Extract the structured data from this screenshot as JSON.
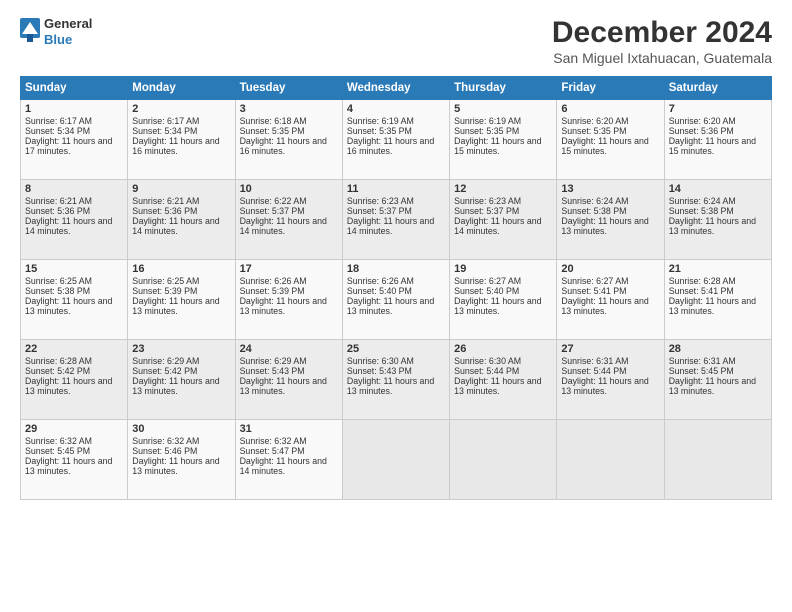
{
  "logo": {
    "general": "General",
    "blue": "Blue"
  },
  "title": "December 2024",
  "subtitle": "San Miguel Ixtahuacan, Guatemala",
  "days_of_week": [
    "Sunday",
    "Monday",
    "Tuesday",
    "Wednesday",
    "Thursday",
    "Friday",
    "Saturday"
  ],
  "weeks": [
    [
      {
        "day": "1",
        "sunrise": "6:17 AM",
        "sunset": "5:34 PM",
        "daylight": "11 hours and 17 minutes."
      },
      {
        "day": "2",
        "sunrise": "6:17 AM",
        "sunset": "5:34 PM",
        "daylight": "11 hours and 16 minutes."
      },
      {
        "day": "3",
        "sunrise": "6:18 AM",
        "sunset": "5:35 PM",
        "daylight": "11 hours and 16 minutes."
      },
      {
        "day": "4",
        "sunrise": "6:19 AM",
        "sunset": "5:35 PM",
        "daylight": "11 hours and 16 minutes."
      },
      {
        "day": "5",
        "sunrise": "6:19 AM",
        "sunset": "5:35 PM",
        "daylight": "11 hours and 15 minutes."
      },
      {
        "day": "6",
        "sunrise": "6:20 AM",
        "sunset": "5:35 PM",
        "daylight": "11 hours and 15 minutes."
      },
      {
        "day": "7",
        "sunrise": "6:20 AM",
        "sunset": "5:36 PM",
        "daylight": "11 hours and 15 minutes."
      }
    ],
    [
      {
        "day": "8",
        "sunrise": "6:21 AM",
        "sunset": "5:36 PM",
        "daylight": "11 hours and 14 minutes."
      },
      {
        "day": "9",
        "sunrise": "6:21 AM",
        "sunset": "5:36 PM",
        "daylight": "11 hours and 14 minutes."
      },
      {
        "day": "10",
        "sunrise": "6:22 AM",
        "sunset": "5:37 PM",
        "daylight": "11 hours and 14 minutes."
      },
      {
        "day": "11",
        "sunrise": "6:23 AM",
        "sunset": "5:37 PM",
        "daylight": "11 hours and 14 minutes."
      },
      {
        "day": "12",
        "sunrise": "6:23 AM",
        "sunset": "5:37 PM",
        "daylight": "11 hours and 14 minutes."
      },
      {
        "day": "13",
        "sunrise": "6:24 AM",
        "sunset": "5:38 PM",
        "daylight": "11 hours and 13 minutes."
      },
      {
        "day": "14",
        "sunrise": "6:24 AM",
        "sunset": "5:38 PM",
        "daylight": "11 hours and 13 minutes."
      }
    ],
    [
      {
        "day": "15",
        "sunrise": "6:25 AM",
        "sunset": "5:38 PM",
        "daylight": "11 hours and 13 minutes."
      },
      {
        "day": "16",
        "sunrise": "6:25 AM",
        "sunset": "5:39 PM",
        "daylight": "11 hours and 13 minutes."
      },
      {
        "day": "17",
        "sunrise": "6:26 AM",
        "sunset": "5:39 PM",
        "daylight": "11 hours and 13 minutes."
      },
      {
        "day": "18",
        "sunrise": "6:26 AM",
        "sunset": "5:40 PM",
        "daylight": "11 hours and 13 minutes."
      },
      {
        "day": "19",
        "sunrise": "6:27 AM",
        "sunset": "5:40 PM",
        "daylight": "11 hours and 13 minutes."
      },
      {
        "day": "20",
        "sunrise": "6:27 AM",
        "sunset": "5:41 PM",
        "daylight": "11 hours and 13 minutes."
      },
      {
        "day": "21",
        "sunrise": "6:28 AM",
        "sunset": "5:41 PM",
        "daylight": "11 hours and 13 minutes."
      }
    ],
    [
      {
        "day": "22",
        "sunrise": "6:28 AM",
        "sunset": "5:42 PM",
        "daylight": "11 hours and 13 minutes."
      },
      {
        "day": "23",
        "sunrise": "6:29 AM",
        "sunset": "5:42 PM",
        "daylight": "11 hours and 13 minutes."
      },
      {
        "day": "24",
        "sunrise": "6:29 AM",
        "sunset": "5:43 PM",
        "daylight": "11 hours and 13 minutes."
      },
      {
        "day": "25",
        "sunrise": "6:30 AM",
        "sunset": "5:43 PM",
        "daylight": "11 hours and 13 minutes."
      },
      {
        "day": "26",
        "sunrise": "6:30 AM",
        "sunset": "5:44 PM",
        "daylight": "11 hours and 13 minutes."
      },
      {
        "day": "27",
        "sunrise": "6:31 AM",
        "sunset": "5:44 PM",
        "daylight": "11 hours and 13 minutes."
      },
      {
        "day": "28",
        "sunrise": "6:31 AM",
        "sunset": "5:45 PM",
        "daylight": "11 hours and 13 minutes."
      }
    ],
    [
      {
        "day": "29",
        "sunrise": "6:32 AM",
        "sunset": "5:45 PM",
        "daylight": "11 hours and 13 minutes."
      },
      {
        "day": "30",
        "sunrise": "6:32 AM",
        "sunset": "5:46 PM",
        "daylight": "11 hours and 13 minutes."
      },
      {
        "day": "31",
        "sunrise": "6:32 AM",
        "sunset": "5:47 PM",
        "daylight": "11 hours and 14 minutes."
      },
      null,
      null,
      null,
      null
    ]
  ],
  "labels": {
    "sunrise": "Sunrise:",
    "sunset": "Sunset:",
    "daylight": "Daylight:"
  }
}
